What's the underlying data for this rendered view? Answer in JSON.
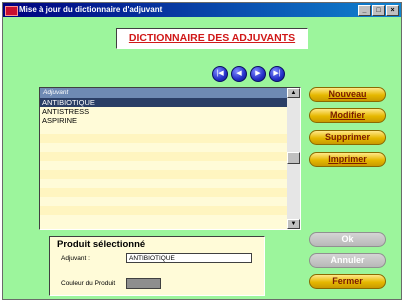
{
  "window": {
    "title": "Mise à jour du dictionnaire d'adjuvant",
    "controls": [
      "_",
      "□",
      "×"
    ]
  },
  "heading": "DICTIONNAIRE DES ADJUVANTS",
  "navigation": [
    {
      "icon": "first-record-icon",
      "glyph": "|◀"
    },
    {
      "icon": "previous-record-icon",
      "glyph": "◀"
    },
    {
      "icon": "next-record-icon",
      "glyph": "▶"
    },
    {
      "icon": "last-record-icon",
      "glyph": "▶|"
    }
  ],
  "list": {
    "column_header": "Adjuvant",
    "rows": [
      "ANTIBIOTIQUE",
      "ANTISTRESS",
      "ASPIRINE"
    ],
    "selected_index": 0
  },
  "actions": {
    "nouveau": "Nouveau",
    "modifier": "Modifier",
    "supprimer": "Supprimer",
    "imprimer": "Imprimer",
    "ok": "Ok",
    "annuler": "Annuler",
    "fermer": "Fermer"
  },
  "selected_product": {
    "title": "Produit sélectionné",
    "adjuvant_label": "Adjuvant :",
    "adjuvant_value": "ANTIBIOTIQUE",
    "color_label": "Couleur du Produit",
    "color_value": "#8e8e8e"
  },
  "colors": {
    "window_bg": "#9cf59c",
    "heading_text": "#d01818",
    "selection": "#2a3e66",
    "button_gold": "#e6b800"
  }
}
